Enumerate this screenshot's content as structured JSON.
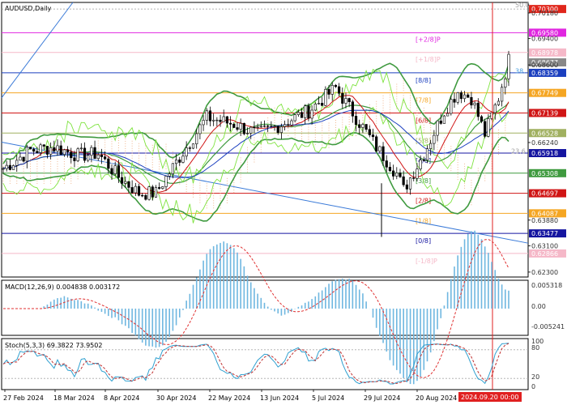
{
  "title": "AUDUSD,Daily",
  "price_chart": {
    "price_labels": [
      {
        "text": "0.70300",
        "value": 0.703,
        "bg": "#e0261b",
        "fg": "#ffffff"
      },
      {
        "text": "0.70180",
        "value": 0.7018,
        "bg": "",
        "fg": "#333333"
      },
      {
        "text": "0.69580",
        "value": 0.6958,
        "bg": "#e026e0",
        "fg": "#ffffff"
      },
      {
        "text": "0.69400",
        "value": 0.694,
        "bg": "",
        "fg": "#333333"
      },
      {
        "text": "0.68978",
        "value": 0.68978,
        "bg": "#f5b8c8",
        "fg": "#ffffff"
      },
      {
        "text": "0.68677",
        "value": 0.68677,
        "bg": "#888888",
        "fg": "#ffffff"
      },
      {
        "text": "0.68600",
        "value": 0.686,
        "bg": "",
        "fg": "#333333"
      },
      {
        "text": "0.68359",
        "value": 0.68359,
        "bg": "#1b3fbf",
        "fg": "#ffffff"
      },
      {
        "text": "0.67749",
        "value": 0.67749,
        "bg": "#f5a623",
        "fg": "#ffffff"
      },
      {
        "text": "0.67139",
        "value": 0.67139,
        "bg": "#d01515",
        "fg": "#ffffff"
      },
      {
        "text": "0.66240",
        "value": 0.6624,
        "bg": "",
        "fg": "#333333"
      },
      {
        "text": "0.66528",
        "value": 0.66528,
        "bg": "#a0b060",
        "fg": "#ffffff"
      },
      {
        "text": "0.65918",
        "value": 0.65918,
        "bg": "#1515a0",
        "fg": "#ffffff"
      },
      {
        "text": "0.65308",
        "value": 0.65308,
        "bg": "#3f9a3f",
        "fg": "#ffffff"
      },
      {
        "text": "0.64697",
        "value": 0.64697,
        "bg": "#d01515",
        "fg": "#ffffff"
      },
      {
        "text": "0.64087",
        "value": 0.64087,
        "bg": "#f5a623",
        "fg": "#ffffff"
      },
      {
        "text": "0.63880",
        "value": 0.6388,
        "bg": "",
        "fg": "#333333"
      },
      {
        "text": "0.63477",
        "value": 0.63477,
        "bg": "#1515a0",
        "fg": "#ffffff"
      },
      {
        "text": "0.63100",
        "value": 0.631,
        "bg": "",
        "fg": "#333333"
      },
      {
        "text": "0.62866",
        "value": 0.62866,
        "bg": "#f5b8c8",
        "fg": "#ffffff"
      },
      {
        "text": "0.62300",
        "value": 0.623,
        "bg": "",
        "fg": "#333333"
      }
    ],
    "murrey_levels": [
      {
        "label": "[+2/8]P",
        "value": 0.6958,
        "color": "#e026e0"
      },
      {
        "label": "[+1/8]P",
        "value": 0.68978,
        "color": "#f5b8c8"
      },
      {
        "label": "[8/8]",
        "value": 0.68359,
        "color": "#1b3fbf"
      },
      {
        "label": "[7/8]",
        "value": 0.67749,
        "color": "#f5a623"
      },
      {
        "label": "[6/8]",
        "value": 0.67139,
        "color": "#d01515"
      },
      {
        "label": "[5/8]",
        "value": 0.66528,
        "color": "#a0b060"
      },
      {
        "label": "[4/8]",
        "value": 0.65918,
        "color": "#1515a0"
      },
      {
        "label": "[3/8]",
        "value": 0.65308,
        "color": "#3f9a3f"
      },
      {
        "label": "[2/8]",
        "value": 0.64697,
        "color": "#d01515"
      },
      {
        "label": "[1/8]",
        "value": 0.64087,
        "color": "#f5a623"
      },
      {
        "label": "[0/8]",
        "value": 0.63477,
        "color": "#1515a0"
      },
      {
        "label": "[-1/8]P",
        "value": 0.62866,
        "color": "#f5b8c8"
      }
    ],
    "side_marks": [
      {
        "text": "38.",
        "value": 0.684,
        "color": "#4aa0e0"
      },
      {
        "text": "23.6",
        "value": 0.6595,
        "color": "#a0a0a0"
      },
      {
        "text": "50.0",
        "value": 0.703,
        "color": "#a0a0a0"
      }
    ]
  },
  "macd": {
    "label": "MACD(12,26,9) 0.004838 0.003172",
    "axis": [
      "0.005318",
      "0.00",
      "-0.005241"
    ]
  },
  "stoch": {
    "label": "Stoch(5,3,3) 69.3822 73.9502",
    "axis": [
      "100",
      "80",
      "20",
      "0"
    ]
  },
  "time_axis": {
    "labels": [
      "27 Feb 2024",
      "18 Mar 2024",
      "8 Apr 2024",
      "30 Apr 2024",
      "22 May 2024",
      "13 Jun 2024",
      "5 Jul 2024",
      "29 Jul 2024",
      "20 Aug 2024"
    ],
    "current": "2024.09.20 00:00"
  },
  "colors": {
    "bull_candle": "#000000",
    "bear_candle": "#000000",
    "ma_fast": "#d01515",
    "ma_slow": "#1b3fbf",
    "bollinger": "#3f9a3f",
    "envelope": "#7ee33f",
    "macd_hist": "#6fb7e0",
    "macd_signal": "#e03030",
    "stoch_main": "#2fa0d0",
    "stoch_signal": "#c03030",
    "cursor": "#e02020"
  }
}
